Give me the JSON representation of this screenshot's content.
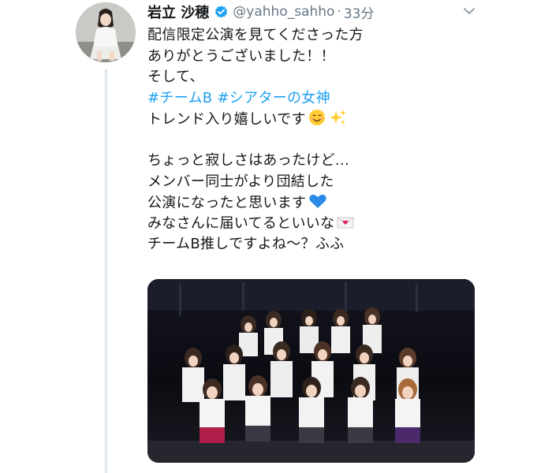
{
  "user": {
    "display_name": "岩立 沙穂",
    "handle": "@yahho_sahho",
    "separator": "·",
    "time_ago": "33分",
    "verified": true,
    "avatar_icon": "user-avatar-icon"
  },
  "tweet": {
    "lines": [
      "配信限定公演を見てくださった方",
      "ありがとうございました！！",
      "そして、"
    ],
    "hashtags": [
      "#チームB",
      "#シアターの女神"
    ],
    "line_trend": "トレンド入り嬉しいです",
    "lines2": [
      "ちょっと寂しさはあったけど...",
      "メンバー同士がより団結した"
    ],
    "line_performance": "公演になったと思います",
    "line_hope": "みなさんに届いてるといいな",
    "line_last": "チームB推しですよね〜？ふふ"
  },
  "icons": {
    "verified": "verified-badge-icon",
    "chevron": "chevron-down-icon",
    "emoji_smile": "smiling-face-emoji",
    "emoji_sparkles": "sparkles-emoji",
    "emoji_heart": "blue-heart-emoji",
    "emoji_letter": "love-letter-emoji"
  },
  "colors": {
    "hashtag": "#1da1f2",
    "verified": "#1da1f2",
    "muted": "#657786",
    "thread_line": "#e1e8ed"
  }
}
